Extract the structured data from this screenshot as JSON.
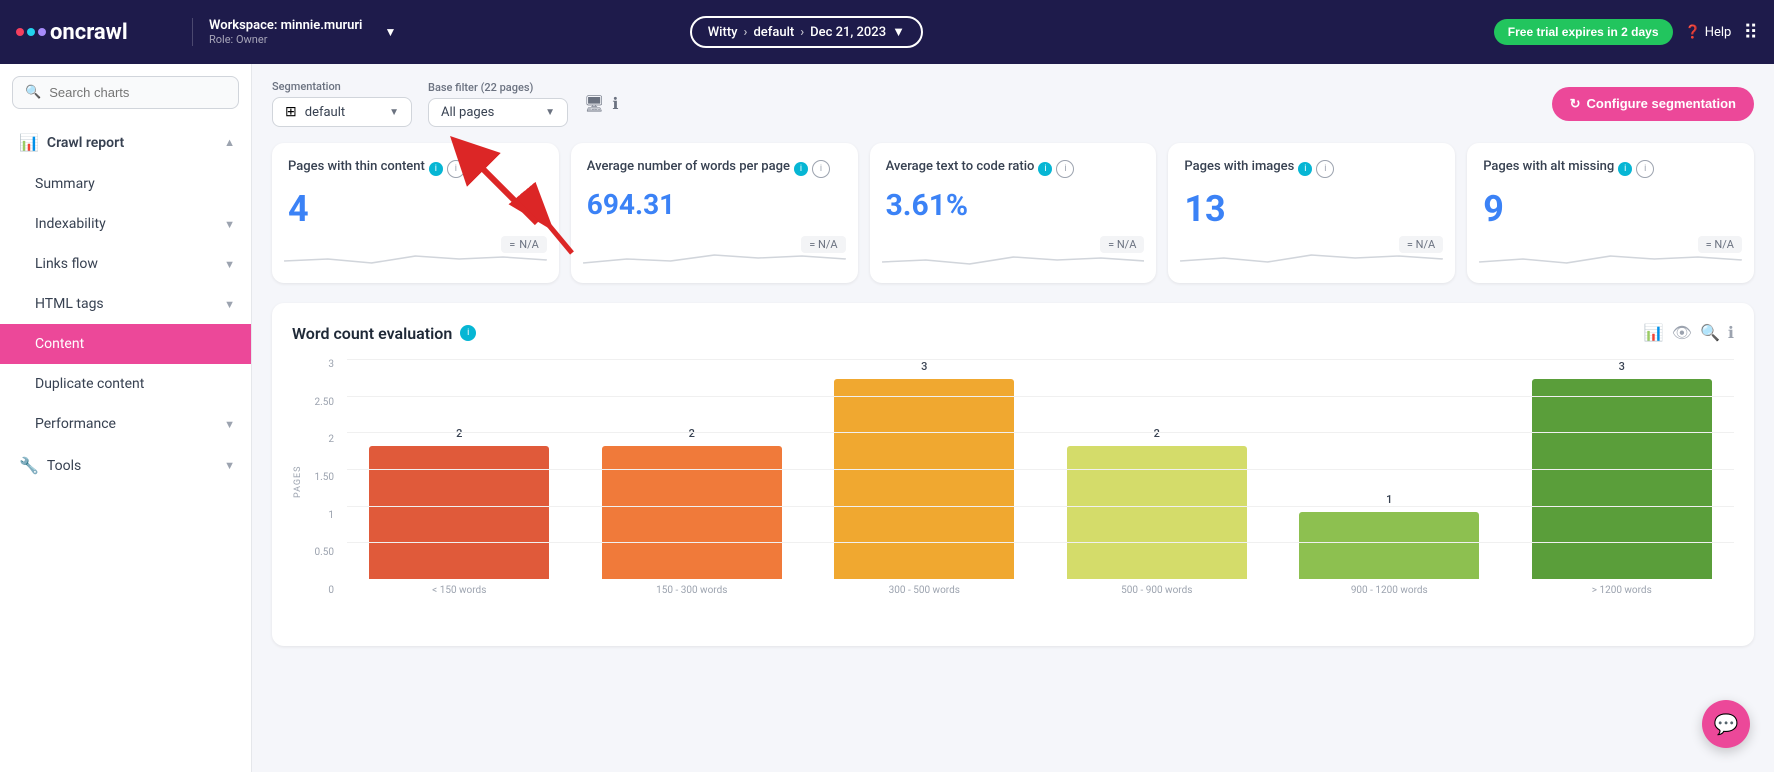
{
  "topnav": {
    "logo": "oncrawl",
    "workspace_label": "Workspace: minnie.mururi",
    "role_label": "Role: Owner",
    "breadcrumb": {
      "site": "Witty",
      "env": "default",
      "date": "Dec 21, 2023"
    },
    "free_trial_label": "Free trial expires in 2 days",
    "help_label": "Help"
  },
  "sidebar": {
    "search_placeholder": "Search charts",
    "items": [
      {
        "id": "crawl-report",
        "label": "Crawl report",
        "icon": "📊",
        "has_arrow": true,
        "active": false,
        "is_parent": true
      },
      {
        "id": "summary",
        "label": "Summary",
        "icon": "",
        "has_arrow": false,
        "active": false
      },
      {
        "id": "indexability",
        "label": "Indexability",
        "icon": "",
        "has_arrow": true,
        "active": false
      },
      {
        "id": "links-flow",
        "label": "Links flow",
        "icon": "",
        "has_arrow": true,
        "active": false
      },
      {
        "id": "html-tags",
        "label": "HTML tags",
        "icon": "",
        "has_arrow": true,
        "active": false
      },
      {
        "id": "content",
        "label": "Content",
        "icon": "",
        "has_arrow": false,
        "active": true
      },
      {
        "id": "duplicate-content",
        "label": "Duplicate content",
        "icon": "",
        "has_arrow": false,
        "active": false
      },
      {
        "id": "performance",
        "label": "Performance",
        "icon": "",
        "has_arrow": true,
        "active": false
      },
      {
        "id": "tools",
        "label": "Tools",
        "icon": "🔧",
        "has_arrow": true,
        "active": false
      }
    ]
  },
  "controls": {
    "segmentation_label": "Segmentation",
    "base_filter_label": "Base filter (22 pages)",
    "segmentation_value": "default",
    "base_filter_value": "All pages",
    "configure_btn": "Configure segmentation"
  },
  "metrics": [
    {
      "title": "Pages with thin content",
      "value": "4",
      "badge": "= N/A"
    },
    {
      "title": "Average number of words per page",
      "value": "694.31",
      "badge": "= N/A"
    },
    {
      "title": "Average text to code ratio",
      "value": "3.61%",
      "badge": "= N/A"
    },
    {
      "title": "Pages with images",
      "value": "13",
      "badge": "= N/A"
    },
    {
      "title": "Pages with alt missing",
      "value": "9",
      "badge": "= N/A"
    }
  ],
  "chart": {
    "title": "Word count evaluation",
    "y_axis_label": "PAGES",
    "bars": [
      {
        "label": "< 150 words",
        "value": 2,
        "color": "#e05a3a"
      },
      {
        "label": "150 - 300 words",
        "value": 2,
        "color": "#f07a3a"
      },
      {
        "label": "300 - 500 words",
        "value": 3,
        "color": "#f0a830"
      },
      {
        "label": "500 - 900 words",
        "value": 2,
        "color": "#d4dc6a"
      },
      {
        "label": "900 - 1200 words",
        "value": 1,
        "color": "#8dc050"
      },
      {
        "label": "> 1200 words",
        "value": 3,
        "color": "#5a9e3a"
      }
    ],
    "y_max": 3,
    "y_ticks": [
      "3",
      "2.50",
      "2",
      "1.50",
      "1",
      "0.50",
      "0"
    ]
  }
}
